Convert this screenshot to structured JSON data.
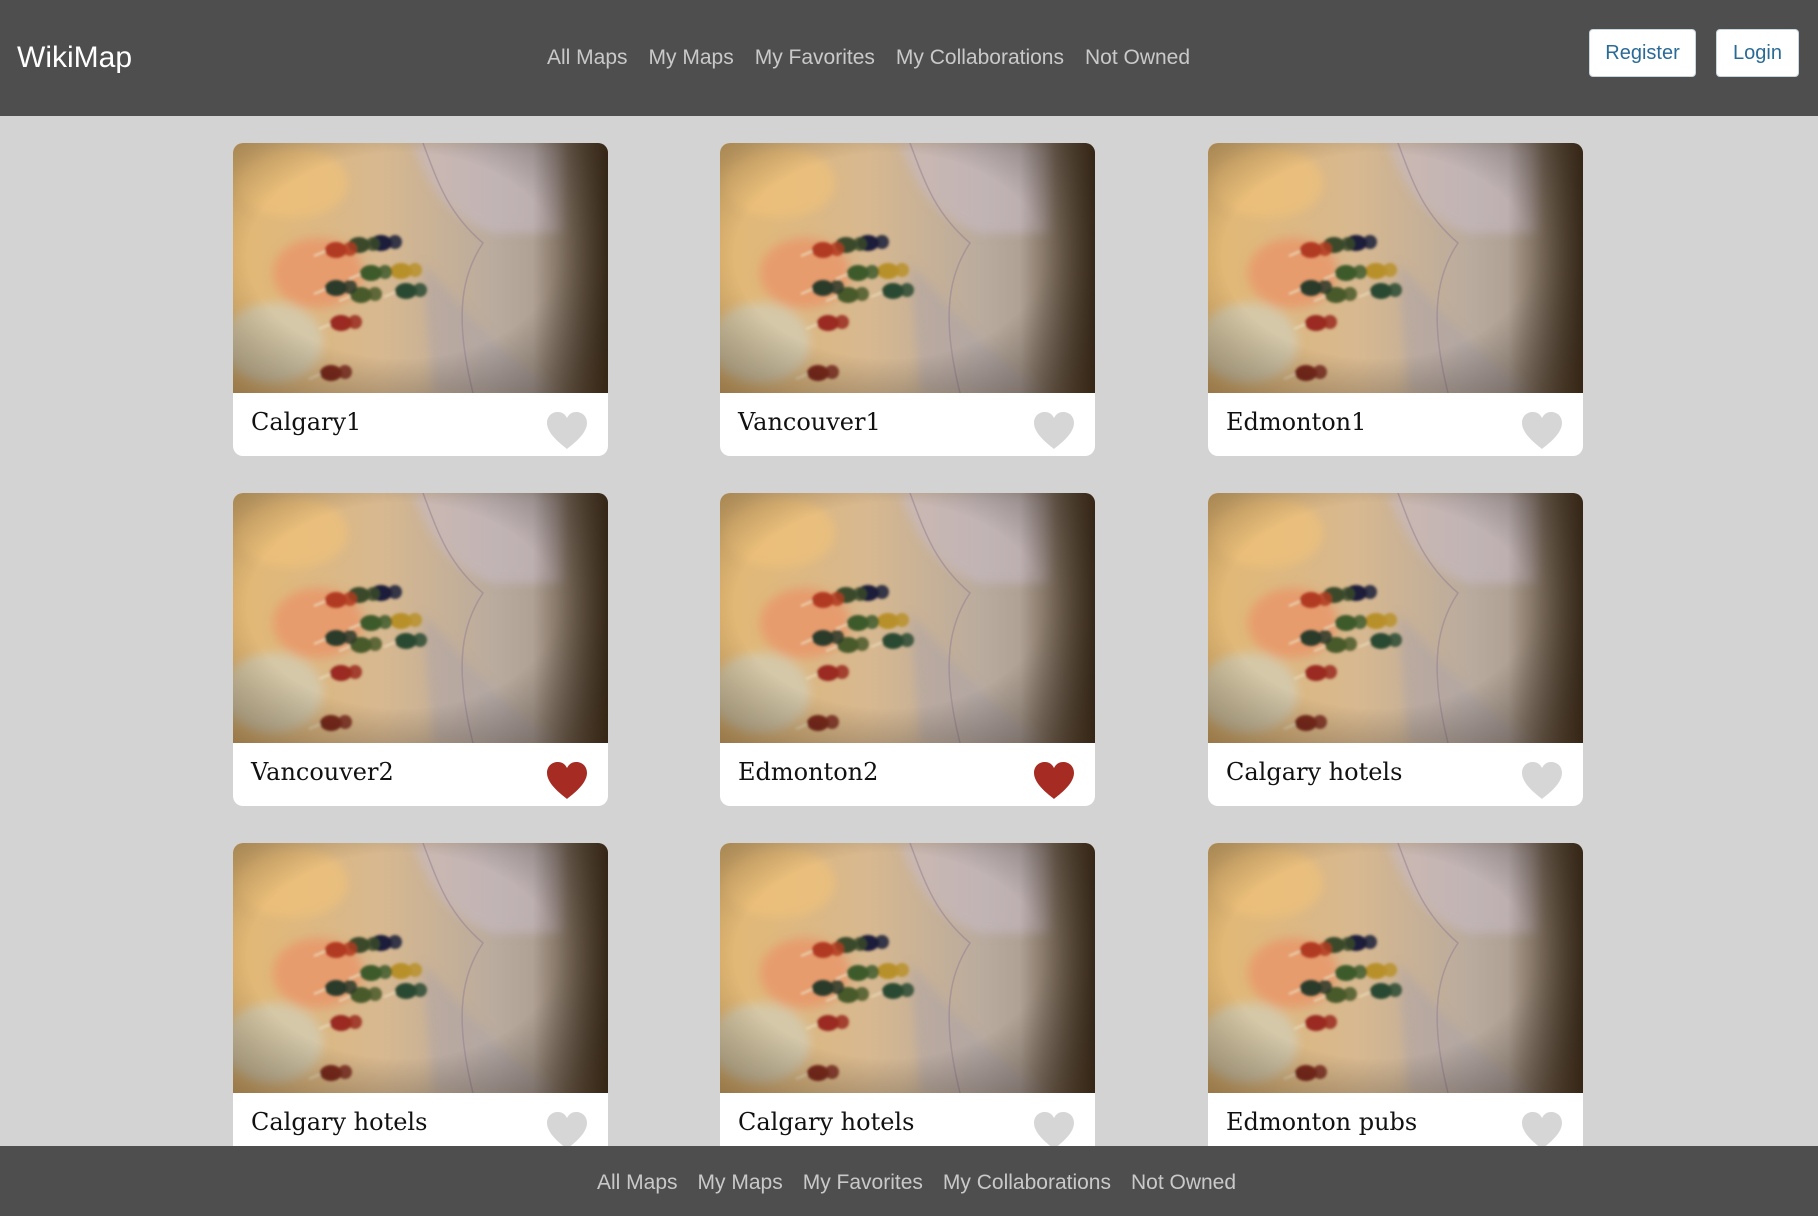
{
  "navbar": {
    "brand": "WikiMap",
    "links": [
      "All Maps",
      "My Maps",
      "My Favorites",
      "My Collaborations",
      "Not Owned"
    ],
    "register_label": "Register",
    "login_label": "Login"
  },
  "maps": [
    {
      "title": "Calgary1",
      "favorited": false
    },
    {
      "title": "Vancouver1",
      "favorited": false
    },
    {
      "title": "Edmonton1",
      "favorited": false
    },
    {
      "title": "Vancouver2",
      "favorited": true
    },
    {
      "title": "Edmonton2",
      "favorited": true
    },
    {
      "title": "Calgary hotels",
      "favorited": false
    },
    {
      "title": "Calgary hotels",
      "favorited": false
    },
    {
      "title": "Calgary hotels",
      "favorited": false
    },
    {
      "title": "Edmonton pubs",
      "favorited": false
    }
  ],
  "footer": {
    "links": [
      "All Maps",
      "My Maps",
      "My Favorites",
      "My Collaborations",
      "Not Owned"
    ]
  },
  "colors": {
    "navbar_bg": "#4e4e4e",
    "page_bg": "#d3d3d3",
    "heart_favorited": "#a62b22",
    "heart_default": "#d6d6d6",
    "button_text": "#2a6b96"
  },
  "icons": {
    "favorite": "heart-icon"
  }
}
